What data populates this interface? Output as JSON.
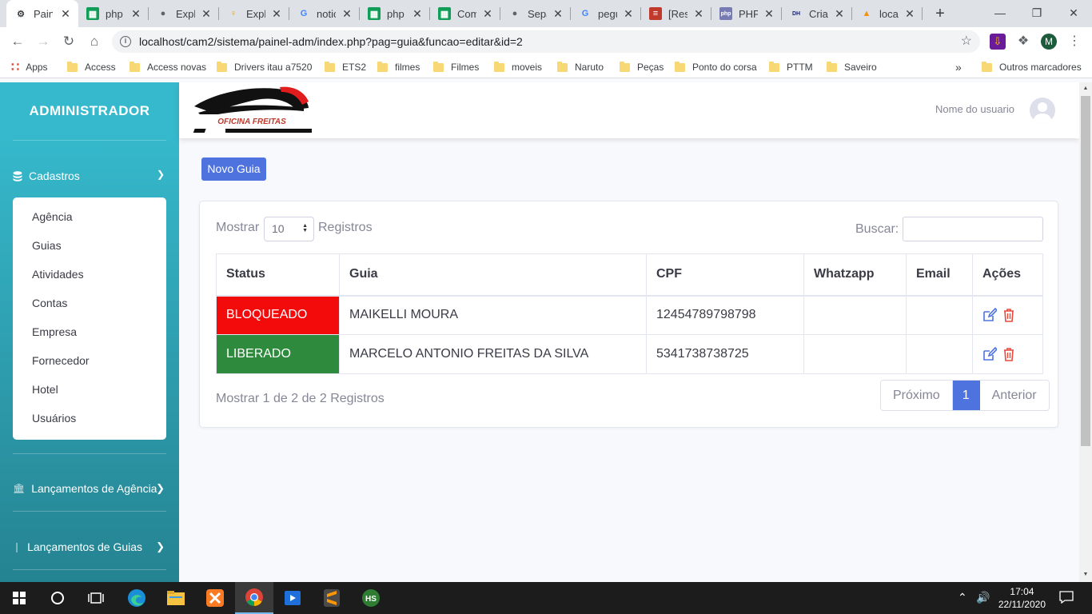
{
  "browser": {
    "tabs": [
      {
        "label": "Painel",
        "icon": "gear-icon",
        "active": true
      },
      {
        "label": "php",
        "icon": "sheet-icon"
      },
      {
        "label": "Explo",
        "icon": "globe-icon"
      },
      {
        "label": "Explo",
        "icon": "person-icon"
      },
      {
        "label": "notic",
        "icon": "google-icon"
      },
      {
        "label": "php",
        "icon": "sheet-icon"
      },
      {
        "label": "Com",
        "icon": "sheet-icon"
      },
      {
        "label": "Sepa",
        "icon": "globe-icon"
      },
      {
        "label": "pegu",
        "icon": "google-icon"
      },
      {
        "label": "[Res",
        "icon": "books-icon"
      },
      {
        "label": "PHP",
        "icon": "php-icon"
      },
      {
        "label": "Criar",
        "icon": "dh-icon"
      },
      {
        "label": "local",
        "icon": "pma-icon"
      }
    ],
    "new_tab": "+",
    "window_controls": {
      "minimize": "—",
      "maximize": "❐",
      "close": "✕"
    },
    "url": "localhost/cam2/sistema/painel-adm/index.php?pag=guia&funcao=editar&id=2",
    "profile_initial": "M",
    "bookmarks": [
      "Apps",
      "Access",
      "Access novas",
      "Drivers itau a7520",
      "ETS2",
      "filmes",
      "Filmes",
      "moveis",
      "Naruto",
      "Peças",
      "Ponto do corsa",
      "PTTM",
      "Saveiro"
    ],
    "bookmarks_more": "»",
    "other_bookmarks": "Outros marcadores"
  },
  "sidebar": {
    "brand": "ADMINISTRADOR",
    "section": "Cadastros",
    "items": [
      "Agência",
      "Guias",
      "Atividades",
      "Contas",
      "Empresa",
      "Fornecedor",
      "Hotel",
      "Usuários"
    ],
    "nav": [
      "Lançamentos de Agência",
      "Lançamentos de Guias"
    ]
  },
  "topbar": {
    "logo_text": "OFICINA FREITAS",
    "user": "Nome do usuario"
  },
  "main": {
    "new_button": "Novo Guia",
    "length_label": "Mostrar",
    "length_value": "10",
    "records_label": "Registros",
    "search_label": "Buscar:",
    "search_value": "",
    "columns": [
      "Status",
      "Guia",
      "CPF",
      "Whatzapp",
      "Email",
      "Ações"
    ],
    "rows": [
      {
        "status": "BLOQUEADO",
        "guia": "MAIKELLI MOURA",
        "cpf": "12454789798798",
        "whatsapp": "",
        "email": ""
      },
      {
        "status": "LIBERADO",
        "guia": "MARCELO ANTONIO FREITAS DA SILVA",
        "cpf": "5341738738725",
        "whatsapp": "",
        "email": ""
      }
    ],
    "info": "Mostrar 1 de 2 de 2 Registros",
    "pager": {
      "next": "Próximo",
      "current": "1",
      "prev": "Anterior"
    }
  },
  "taskbar": {
    "time": "17:04",
    "date": "22/11/2020"
  },
  "colors": {
    "sidebar": "#36b9cc",
    "primary": "#4e73df",
    "blocked": "#f30b0b",
    "free": "#2e8b3e",
    "edit_icon": "#4e73df",
    "delete_icon": "#e74a3b"
  }
}
